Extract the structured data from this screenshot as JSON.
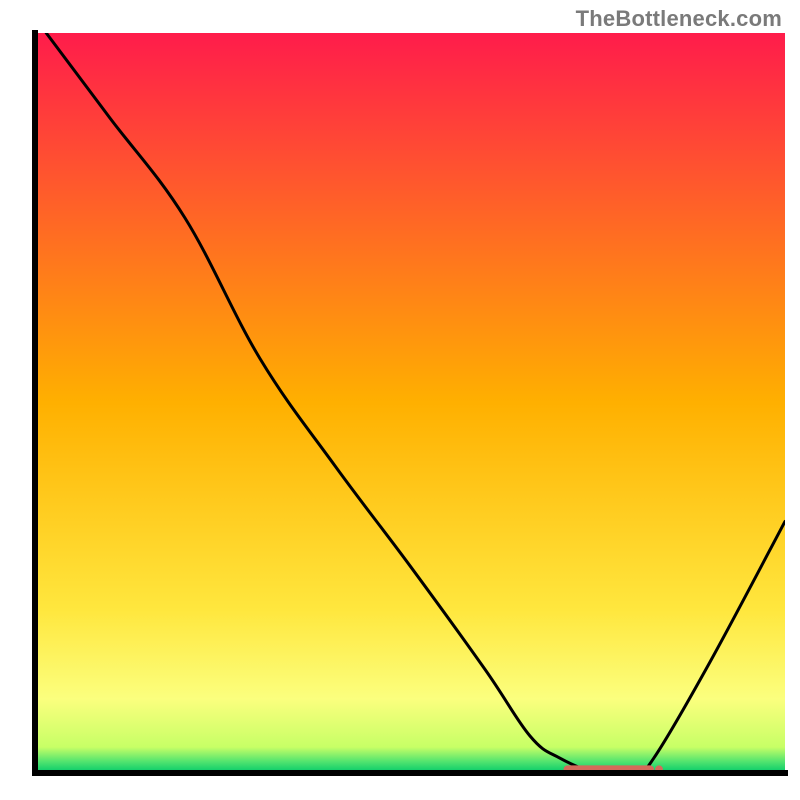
{
  "attribution": "TheBottleneck.com",
  "chart_data": {
    "type": "line",
    "title": "",
    "xlabel": "",
    "ylabel": "",
    "xlim": [
      0,
      100
    ],
    "ylim": [
      0,
      100
    ],
    "grid": false,
    "background_gradient": {
      "stops": [
        {
          "offset": 0.0,
          "color": "#ff1c4b"
        },
        {
          "offset": 0.5,
          "color": "#ffb000"
        },
        {
          "offset": 0.78,
          "color": "#ffe73e"
        },
        {
          "offset": 0.9,
          "color": "#fbff7e"
        },
        {
          "offset": 0.965,
          "color": "#c7ff66"
        },
        {
          "offset": 0.985,
          "color": "#4fe36f"
        },
        {
          "offset": 1.0,
          "color": "#00c96a"
        }
      ]
    },
    "series": [
      {
        "name": "bottleneck-curve",
        "color": "#000000",
        "x": [
          1.5,
          10,
          20,
          30,
          40,
          50,
          60,
          66,
          70,
          75,
          80,
          82.5,
          90,
          100
        ],
        "y": [
          100,
          88.5,
          75,
          56,
          41.5,
          28,
          14,
          5,
          2,
          0,
          0,
          2,
          15,
          34
        ]
      }
    ],
    "marker": {
      "name": "optimal-range-marker",
      "color": "#d46a5a",
      "x_start": 71,
      "x_end": 82,
      "y": 0.5,
      "thickness": 1.3
    },
    "axes": {
      "color": "#000000",
      "thickness": 3
    }
  }
}
